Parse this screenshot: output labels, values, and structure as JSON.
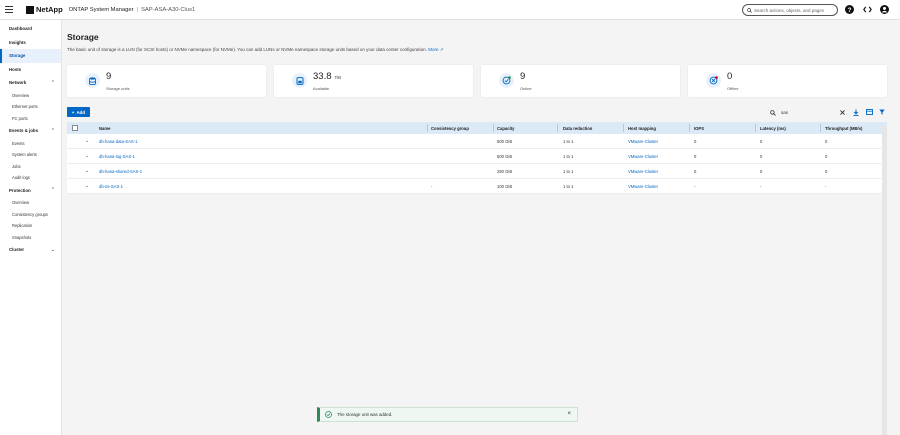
{
  "header": {
    "brand": "NetApp",
    "product": "ONTAP System Manager",
    "separator": "|",
    "cluster": "SAP-ASA-A30-Clus1",
    "search_placeholder": "Search actions, objects, and pages"
  },
  "sidebar": {
    "items": [
      {
        "label": "Dashboard"
      },
      {
        "label": "Insights"
      },
      {
        "label": "Storage"
      },
      {
        "label": "Hosts"
      }
    ],
    "network": {
      "label": "Network",
      "subs": [
        "Overview",
        "Ethernet ports",
        "FC ports"
      ]
    },
    "events": {
      "label": "Events & jobs",
      "subs": [
        "Events",
        "System alerts",
        "Jobs",
        "Audit logs"
      ]
    },
    "protection": {
      "label": "Protection",
      "subs": [
        "Overview",
        "Consistency groups",
        "Replication",
        "Snapshots"
      ]
    },
    "cluster": {
      "label": "Cluster"
    }
  },
  "main": {
    "title": "Storage",
    "description": "The basic unit of storage is a LUN (for SCSI hosts) or NVMe namespace (for NVMe). You can add LUNs or NVMe namespace storage units based on your data center configuration.",
    "more_link": "More"
  },
  "cards": [
    {
      "value": "9",
      "unit": "",
      "label": "Storage units"
    },
    {
      "value": "33.8",
      "unit": "TiB",
      "label": "Available"
    },
    {
      "value": "9",
      "unit": "",
      "label": "Online"
    },
    {
      "value": "0",
      "unit": "",
      "label": "Offline"
    }
  ],
  "toolbar": {
    "add_label": "Add",
    "search_value": "sas"
  },
  "table": {
    "columns": [
      "Name",
      "Consistency group",
      "Capacity",
      "Data reduction",
      "Host mapping",
      "IOPS",
      "Latency (ms)",
      "Throughput (MB/s)"
    ],
    "rows": [
      {
        "name": "db-hana-data-SAS-1",
        "cg": "",
        "capacity": "500 GiB",
        "reduction": "1 to 1",
        "host": "VMware-Cluster",
        "iops": "0",
        "latency": "0",
        "throughput": "0"
      },
      {
        "name": "db-hana-log-SAS-1",
        "cg": "",
        "capacity": "500 GiB",
        "reduction": "1 to 1",
        "host": "VMware-Cluster",
        "iops": "0",
        "latency": "0",
        "throughput": "0"
      },
      {
        "name": "db-hana-shared-SAS-1",
        "cg": "",
        "capacity": "250 GiB",
        "reduction": "1 to 1",
        "host": "VMware-Cluster",
        "iops": "0",
        "latency": "0",
        "throughput": "0"
      },
      {
        "name": "db-os-SAS-1",
        "cg": "-",
        "capacity": "100 GiB",
        "reduction": "1 to 1",
        "host": "VMware-Cluster",
        "iops": "-",
        "latency": "-",
        "throughput": "-"
      }
    ]
  },
  "toast": {
    "message": "The storage unit was added."
  },
  "colors": {
    "accent": "#0067c5",
    "header_row": "#dce9f6",
    "success": "#2e8b57",
    "offline": "#d0021b"
  }
}
